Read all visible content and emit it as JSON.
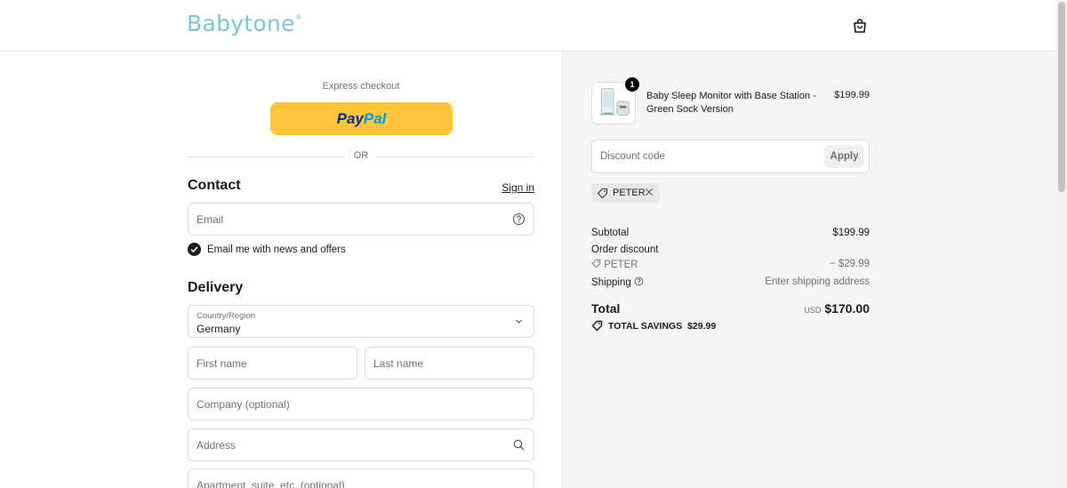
{
  "header": {
    "logo": "Babytone",
    "logo_mark": "®"
  },
  "express": {
    "label": "Express checkout",
    "paypal_a": "Pay",
    "paypal_b": "Pal",
    "or": "OR"
  },
  "contact": {
    "title": "Contact",
    "signin": "Sign in",
    "email_placeholder": "Email",
    "newsletter_label": "Email me with news and offers",
    "newsletter_checked": true
  },
  "delivery": {
    "title": "Delivery",
    "country_label": "Country/Region",
    "country_value": "Germany",
    "first_name_placeholder": "First name",
    "last_name_placeholder": "Last name",
    "company_placeholder": "Company (optional)",
    "address_placeholder": "Address",
    "apartment_placeholder": "Apartment, suite, etc. (optional)"
  },
  "cart": {
    "item_name": "Baby Sleep Monitor with Base Station - Green Sock Version",
    "item_price": "$199.99",
    "item_qty": "1",
    "discount_placeholder": "Discount code",
    "apply_label": "Apply",
    "applied_code": "PETER",
    "subtotal_label": "Subtotal",
    "subtotal_value": "$199.99",
    "order_discount_label": "Order discount",
    "discount_code_label": "PETER",
    "discount_value": "− $29.99",
    "shipping_label": "Shipping",
    "shipping_value": "Enter shipping address",
    "total_label": "Total",
    "total_currency": "USD",
    "total_value": "$170.00",
    "savings_label": "TOTAL SAVINGS",
    "savings_value": "$29.99"
  },
  "colors": {
    "paypal_yellow": "#ffc439",
    "paypal_dark_blue": "#003087",
    "paypal_light_blue": "#009cde",
    "logo_blue": "#7cc4d8"
  }
}
